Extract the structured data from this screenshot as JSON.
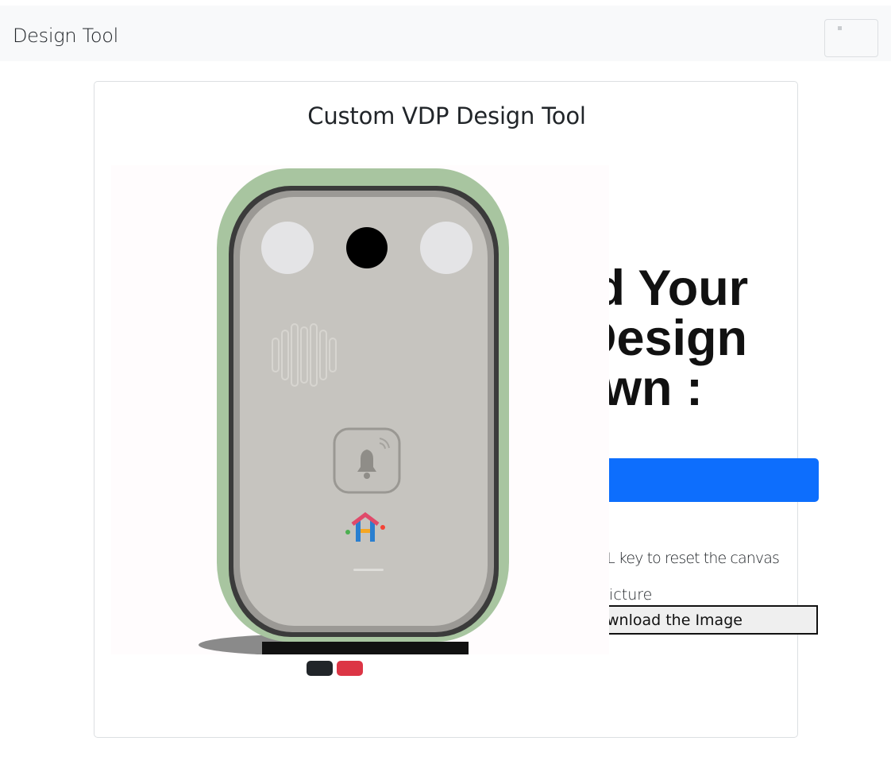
{
  "navbar": {
    "brand": "Design Tool",
    "toggler_icon": "menu-icon"
  },
  "card": {
    "title": "Custom VDP Design Tool"
  },
  "panel": {
    "heading_line1": "oad Your",
    "heading_line2": "n Design",
    "heading_line3": "Down :",
    "reset_hint": "EL key to reset the canvas",
    "picture_hint": "picture",
    "download_label": "wnload the Image"
  },
  "colors": {
    "accent": "#0d6efd",
    "swatch_dark": "#212529",
    "swatch_red": "#dc3545",
    "device_border": "#a8c5a0"
  }
}
